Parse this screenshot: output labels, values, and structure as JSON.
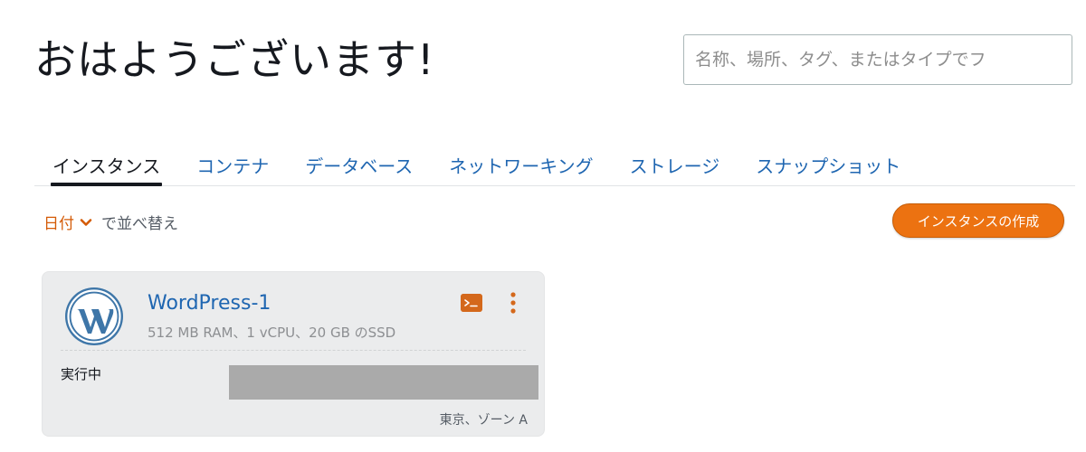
{
  "header": {
    "greeting": "おはようございます!"
  },
  "search": {
    "placeholder": "名称、場所、タグ、またはタイプでフ",
    "value": ""
  },
  "tabs": [
    {
      "label": "インスタンス",
      "active": true
    },
    {
      "label": "コンテナ",
      "active": false
    },
    {
      "label": "データベース",
      "active": false
    },
    {
      "label": "ネットワーキング",
      "active": false
    },
    {
      "label": "ストレージ",
      "active": false
    },
    {
      "label": "スナップショット",
      "active": false
    }
  ],
  "sort": {
    "field": "日付",
    "suffix": "で並べ替え",
    "icon": "chevron-down-icon"
  },
  "actions": {
    "create_label": "インスタンスの作成"
  },
  "instance": {
    "name": "WordPress-1",
    "specs": "512 MB RAM、1 vCPU、20 GB のSSD",
    "state": "実行中",
    "location": "東京、ゾーン A",
    "logo_icon": "wordpress-logo-icon",
    "terminal_icon": "terminal-icon",
    "menu_icon": "more-vertical-icon"
  },
  "colors": {
    "link": "#1f66b1",
    "accent": "#ec7211",
    "sort_accent": "#d45b07",
    "card_bg": "#ebeced",
    "wp_blue": "#3e76a8"
  }
}
